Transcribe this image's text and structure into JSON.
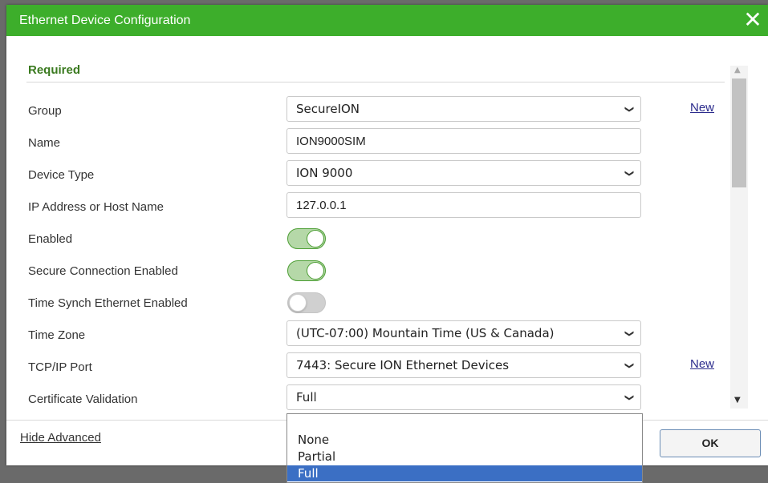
{
  "dialog": {
    "title": "Ethernet Device Configuration",
    "close_label": "✕"
  },
  "section": {
    "title": "Required"
  },
  "fields": {
    "group": {
      "label": "Group",
      "value": "SecureION",
      "new_link": "New"
    },
    "name": {
      "label": "Name",
      "value": "ION9000SIM"
    },
    "device_type": {
      "label": "Device Type",
      "value": "ION 9000"
    },
    "ip": {
      "label": "IP Address or Host Name",
      "value": "127.0.0.1"
    },
    "enabled": {
      "label": "Enabled",
      "state": "on"
    },
    "secure": {
      "label": "Secure Connection Enabled",
      "state": "on"
    },
    "time_synch": {
      "label": "Time Synch Ethernet Enabled",
      "state": "off"
    },
    "time_zone": {
      "label": "Time Zone",
      "value": "(UTC-07:00) Mountain Time (US & Canada)"
    },
    "tcp_port": {
      "label": "TCP/IP Port",
      "value": "7443: Secure ION Ethernet Devices",
      "new_link": "New"
    },
    "cert": {
      "label": "Certificate Validation",
      "value": "Full"
    }
  },
  "dropdown": {
    "options": [
      "None",
      "Partial",
      "Full"
    ],
    "selected": "Full"
  },
  "footer": {
    "hide_advanced": "Hide Advanced",
    "ok": "OK"
  },
  "icons": {
    "chevron": "chevron-down-icon",
    "close": "close-icon"
  },
  "colors": {
    "titlebar": "#3dae2b",
    "section_title": "#3a7a1f",
    "toggle_on": "#4c9e34",
    "selected_option": "#3b6fc4"
  }
}
